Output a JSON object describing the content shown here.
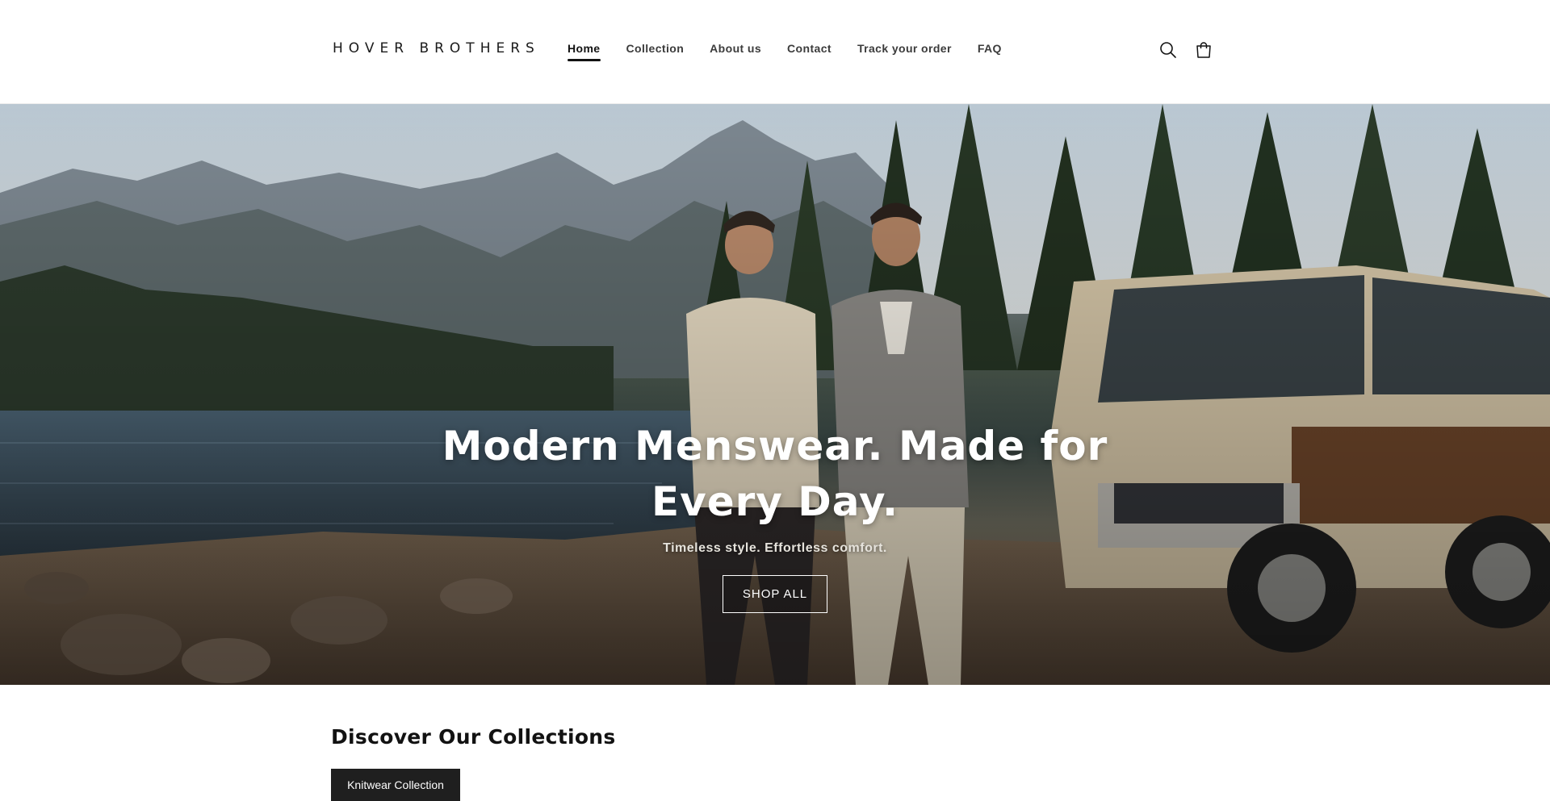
{
  "header": {
    "logo": "HOVER BROTHERS",
    "nav": [
      {
        "label": "Home",
        "active": true
      },
      {
        "label": "Collection",
        "active": false
      },
      {
        "label": "About us",
        "active": false
      },
      {
        "label": "Contact",
        "active": false
      },
      {
        "label": "Track your order",
        "active": false
      },
      {
        "label": "FAQ",
        "active": false
      }
    ],
    "icons": [
      "search-icon",
      "cart-icon"
    ]
  },
  "hero": {
    "title": "Modern Menswear. Made for Every Day.",
    "subtitle": "Timeless style. Effortless comfort.",
    "button": "SHOP ALL"
  },
  "collections": {
    "title": "Discover Our Collections",
    "button": "Knitwear Collection"
  },
  "colors": {
    "text": "#121212",
    "button_dark": "#1f1f1f",
    "hero_text": "#ffffff"
  }
}
